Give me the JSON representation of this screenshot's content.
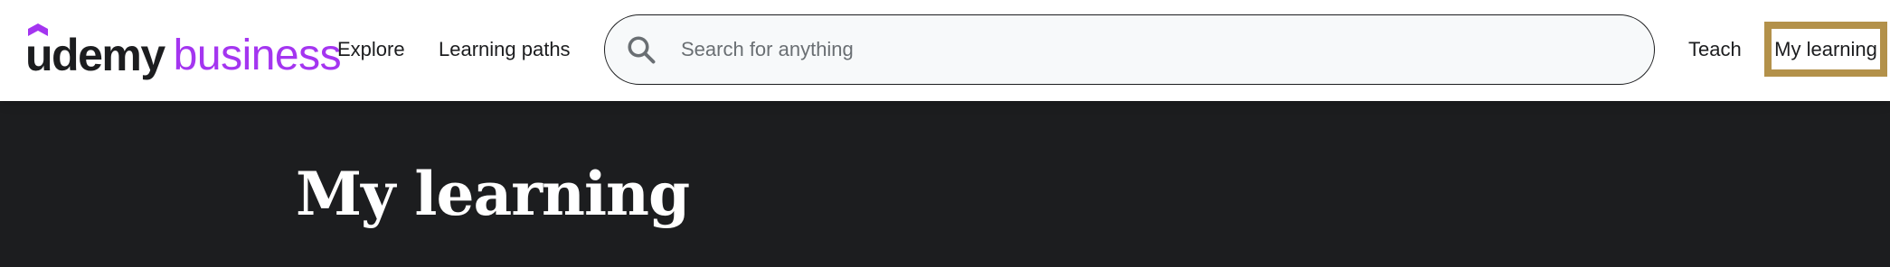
{
  "logo": {
    "brand": "udemy",
    "suffix": "business"
  },
  "nav": {
    "explore": "Explore",
    "learning_paths": "Learning paths",
    "teach": "Teach",
    "my_learning": "My learning"
  },
  "search": {
    "placeholder": "Search for anything",
    "value": ""
  },
  "hero": {
    "title": "My learning"
  },
  "colors": {
    "brand_purple": "#a435f0",
    "text_dark": "#1c1d1f",
    "hero_bg": "#1c1d1f",
    "highlight_border": "#b3914a",
    "search_bg": "#f7f9fa"
  },
  "icons": {
    "search": "search-icon",
    "logo_hat": "udemy-hat-icon"
  }
}
